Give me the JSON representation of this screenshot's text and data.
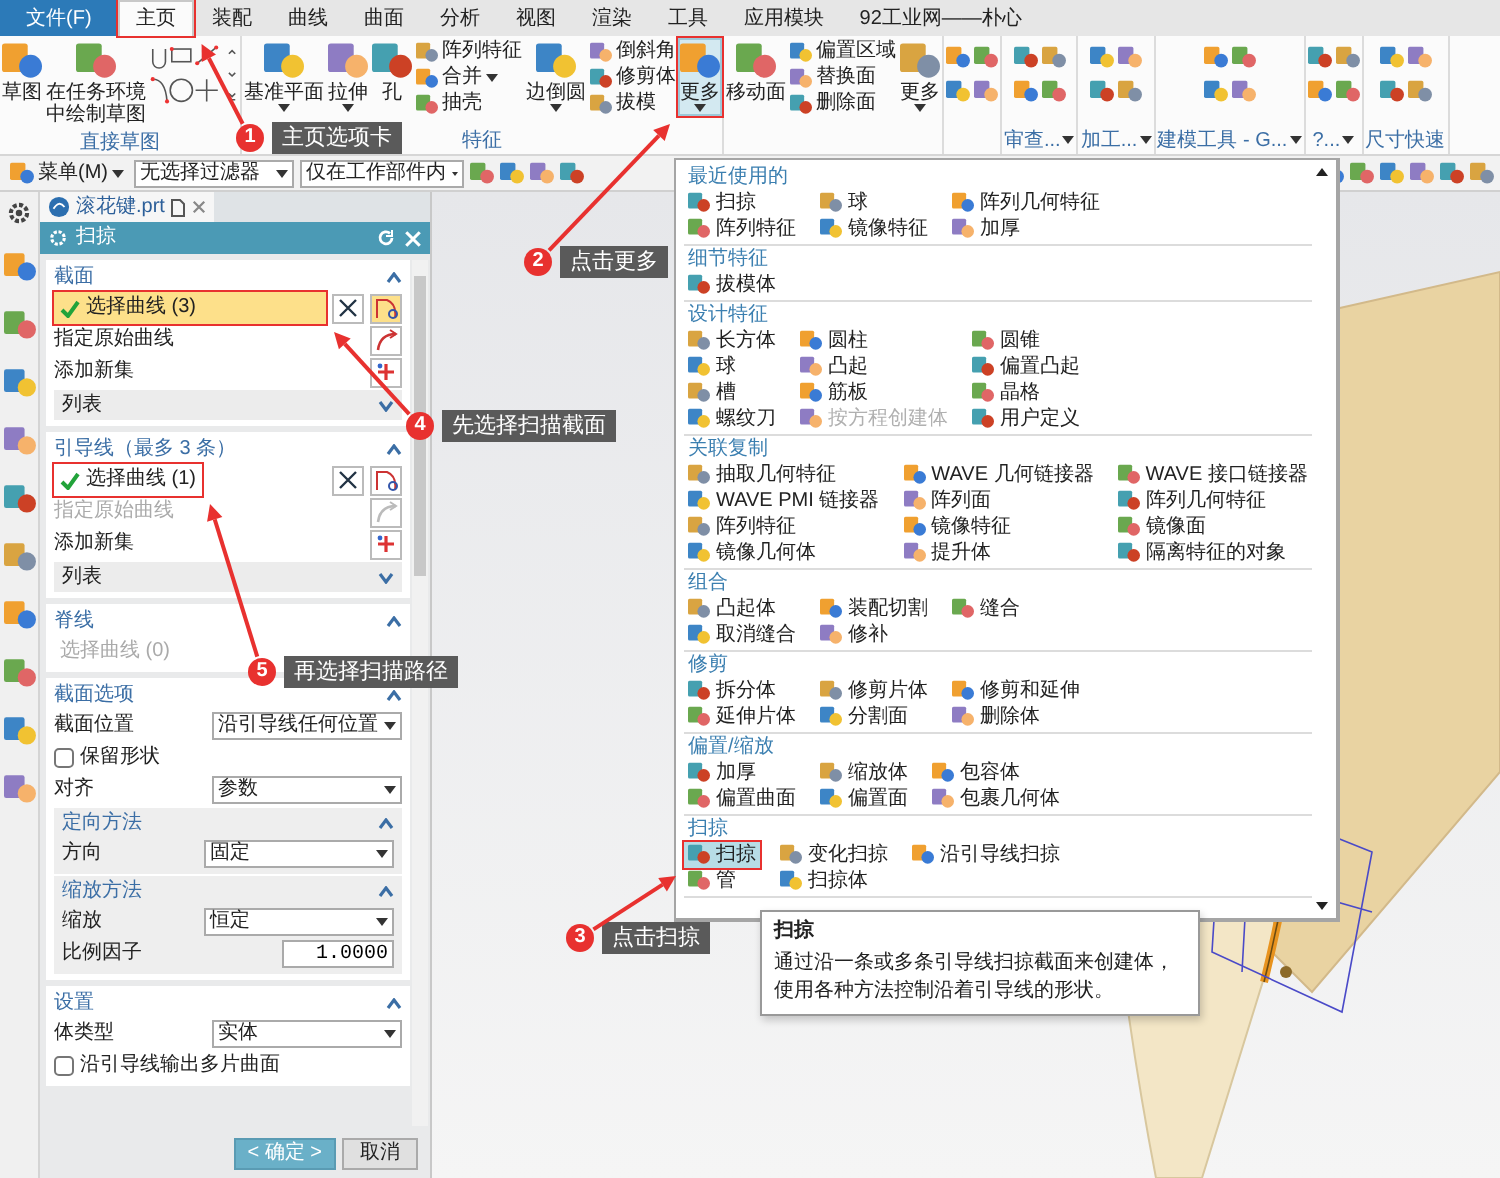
{
  "menu_bar": {
    "tabs": [
      {
        "label": "文件(F)",
        "kind": "file",
        "selected": false
      },
      {
        "label": "主页",
        "kind": "tab",
        "selected": true,
        "callout": {
          "number": "1",
          "text": "主页选项卡"
        }
      },
      {
        "label": "装配",
        "kind": "tab",
        "selected": false
      },
      {
        "label": "曲线",
        "kind": "tab",
        "selected": false
      },
      {
        "label": "曲面",
        "kind": "tab",
        "selected": false
      },
      {
        "label": "分析",
        "kind": "tab",
        "selected": false
      },
      {
        "label": "视图",
        "kind": "tab",
        "selected": false
      },
      {
        "label": "渲染",
        "kind": "tab",
        "selected": false
      },
      {
        "label": "工具",
        "kind": "tab",
        "selected": false
      },
      {
        "label": "应用模块",
        "kind": "tab",
        "selected": false
      },
      {
        "label": "92工业网——朴心",
        "kind": "tab",
        "selected": false
      }
    ]
  },
  "ribbon": {
    "groups": [
      {
        "label": "直接草图",
        "dropdown": false,
        "items": [
          {
            "kind": "large",
            "label": "草图",
            "dropdown": false,
            "pressed": false
          },
          {
            "kind": "large",
            "label": "在任务环境中绘制草图",
            "dropdown": false,
            "pressed": false
          },
          {
            "kind": "gallery"
          }
        ]
      },
      {
        "label": "特征",
        "dropdown": false,
        "items": [
          {
            "kind": "large",
            "label": "基准平面",
            "dropdown": true,
            "pressed": false
          },
          {
            "kind": "large",
            "label": "拉伸",
            "dropdown": true,
            "pressed": false
          },
          {
            "kind": "large",
            "label": "孔",
            "dropdown": false,
            "pressed": false
          },
          {
            "kind": "stack",
            "entries": [
              {
                "label": "阵列特征",
                "dropdown": false
              },
              {
                "label": "合并",
                "dropdown": true
              },
              {
                "label": "抽壳",
                "dropdown": false
              }
            ]
          },
          {
            "kind": "large",
            "label": "边倒圆",
            "dropdown": true,
            "pressed": false
          },
          {
            "kind": "stack",
            "entries": [
              {
                "label": "倒斜角",
                "dropdown": false
              },
              {
                "label": "修剪体",
                "dropdown": false
              },
              {
                "label": "拔模",
                "dropdown": false
              }
            ]
          },
          {
            "kind": "large",
            "label": "更多",
            "dropdown": true,
            "pressed": true,
            "callout": {
              "number": "2",
              "text": "点击更多"
            }
          }
        ]
      },
      {
        "items": [
          {
            "kind": "large",
            "label": "移动面",
            "dropdown": false,
            "pressed": false
          },
          {
            "kind": "stack",
            "entries": [
              {
                "label": "偏置区域",
                "dropdown": false
              },
              {
                "label": "替换面",
                "dropdown": false
              },
              {
                "label": "删除面",
                "dropdown": false
              }
            ]
          },
          {
            "kind": "large",
            "label": "更多",
            "dropdown": true,
            "pressed": false
          }
        ]
      },
      {
        "items": [
          {
            "kind": "icons"
          }
        ]
      },
      {
        "label": "审查...",
        "dropdown": true,
        "items": [
          {
            "kind": "icons"
          }
        ]
      },
      {
        "label": "加工...",
        "dropdown": true,
        "items": [
          {
            "kind": "icons"
          }
        ]
      },
      {
        "label": "建模工具 - G...",
        "dropdown": true,
        "items": [
          {
            "kind": "icons"
          }
        ]
      },
      {
        "label": "?...",
        "dropdown": true,
        "items": [
          {
            "kind": "icons"
          }
        ]
      },
      {
        "label": "尺寸快速",
        "dropdown": false,
        "items": [
          {
            "kind": "icons"
          }
        ]
      }
    ]
  },
  "toolbar": {
    "menu_button": "菜单(M)",
    "filters": [
      "无选择过滤器",
      "仅在工作部件内"
    ]
  },
  "file_tab": {
    "label": "滚花键.prt"
  },
  "dialog": {
    "title": "扫掠",
    "sections": [
      {
        "title": "截面",
        "expanded": true,
        "rows": [
          {
            "kind": "select",
            "label": "选择曲线 (3)",
            "done": true,
            "active": true,
            "disabled": false,
            "callout": {
              "number": "4",
              "text": "先选择扫描截面"
            }
          },
          {
            "kind": "specify",
            "label": "指定原始曲线",
            "disabled": false
          },
          {
            "kind": "add_set",
            "label": "添加新集"
          },
          {
            "kind": "list",
            "label": "列表",
            "expanded": false
          }
        ]
      },
      {
        "title": "引导线（最多 3 条）",
        "expanded": true,
        "rows": [
          {
            "kind": "select",
            "label": "选择曲线 (1)",
            "done": true,
            "active": false,
            "disabled": false,
            "callout": {
              "number": "5",
              "text": "再选择扫描路径"
            }
          },
          {
            "kind": "specify",
            "label": "指定原始曲线",
            "disabled": true
          },
          {
            "kind": "add_set",
            "label": "添加新集"
          },
          {
            "kind": "list",
            "label": "列表",
            "expanded": false
          }
        ]
      },
      {
        "title": "脊线",
        "expanded": true,
        "rows": [
          {
            "kind": "select",
            "label": "选择曲线 (0)",
            "done": false,
            "active": false,
            "disabled": true
          }
        ]
      },
      {
        "title": "截面选项",
        "expanded": true,
        "rows": [
          {
            "kind": "dropdown",
            "label": "截面位置",
            "value": "沿引导线任何位置"
          },
          {
            "kind": "checkbox",
            "label": "保留形状",
            "checked": false
          },
          {
            "kind": "dropdown",
            "label": "对齐",
            "value": "参数"
          },
          {
            "kind": "subsection",
            "title": "定向方法",
            "expanded": true,
            "rows": [
              {
                "kind": "dropdown",
                "label": "方向",
                "value": "固定"
              }
            ]
          },
          {
            "kind": "subsection",
            "title": "缩放方法",
            "expanded": true,
            "rows": [
              {
                "kind": "dropdown",
                "label": "缩放",
                "value": "恒定"
              },
              {
                "kind": "number",
                "label": "比例因子",
                "value": "1.0000"
              }
            ]
          }
        ]
      },
      {
        "title": "设置",
        "expanded": true,
        "rows": [
          {
            "kind": "dropdown",
            "label": "体类型",
            "value": "实体"
          },
          {
            "kind": "checkbox",
            "label": "沿引导线输出多片曲面",
            "checked": false
          }
        ]
      }
    ],
    "buttons": [
      {
        "label": "< 确定 >",
        "primary": true
      },
      {
        "label": "取消",
        "primary": false
      }
    ]
  },
  "menu": {
    "sections": [
      {
        "title": "最近使用的",
        "items": [
          {
            "label": "扫掠",
            "disabled": false,
            "highlighted": false
          },
          {
            "label": "球",
            "disabled": false,
            "highlighted": false
          },
          {
            "label": "阵列几何特征",
            "disabled": false,
            "highlighted": false
          },
          {
            "label": "阵列特征",
            "disabled": false,
            "highlighted": false
          },
          {
            "label": "镜像特征",
            "disabled": false,
            "highlighted": false
          },
          {
            "label": "加厚",
            "disabled": false,
            "highlighted": false
          }
        ]
      },
      {
        "title": "细节特征",
        "items": [
          {
            "label": "拔模体",
            "disabled": false,
            "highlighted": false
          }
        ]
      },
      {
        "title": "设计特征",
        "items": [
          {
            "label": "长方体",
            "disabled": false,
            "highlighted": false
          },
          {
            "label": "圆柱",
            "disabled": false,
            "highlighted": false
          },
          {
            "label": "圆锥",
            "disabled": false,
            "highlighted": false
          },
          {
            "label": "球",
            "disabled": false,
            "highlighted": false
          },
          {
            "label": "凸起",
            "disabled": false,
            "highlighted": false
          },
          {
            "label": "偏置凸起",
            "disabled": false,
            "highlighted": false
          },
          {
            "label": "槽",
            "disabled": false,
            "highlighted": false
          },
          {
            "label": "筋板",
            "disabled": false,
            "highlighted": false
          },
          {
            "label": "晶格",
            "disabled": false,
            "highlighted": false
          },
          {
            "label": "螺纹刀",
            "disabled": false,
            "highlighted": false
          },
          {
            "label": "按方程创建体",
            "disabled": true,
            "highlighted": false
          },
          {
            "label": "用户定义",
            "disabled": false,
            "highlighted": false
          }
        ]
      },
      {
        "title": "关联复制",
        "items": [
          {
            "label": "抽取几何特征",
            "disabled": false,
            "highlighted": false
          },
          {
            "label": "WAVE 几何链接器",
            "disabled": false,
            "highlighted": false
          },
          {
            "label": "WAVE 接口链接器",
            "disabled": false,
            "highlighted": false
          },
          {
            "label": "WAVE PMI 链接器",
            "disabled": false,
            "highlighted": false
          },
          {
            "label": "阵列面",
            "disabled": false,
            "highlighted": false
          },
          {
            "label": "阵列几何特征",
            "disabled": false,
            "highlighted": false
          },
          {
            "label": "阵列特征",
            "disabled": false,
            "highlighted": false
          },
          {
            "label": "镜像特征",
            "disabled": false,
            "highlighted": false
          },
          {
            "label": "镜像面",
            "disabled": false,
            "highlighted": false
          },
          {
            "label": "镜像几何体",
            "disabled": false,
            "highlighted": false
          },
          {
            "label": "提升体",
            "disabled": false,
            "highlighted": false
          },
          {
            "label": "隔离特征的对象",
            "disabled": false,
            "highlighted": false
          }
        ]
      },
      {
        "title": "组合",
        "items": [
          {
            "label": "凸起体",
            "disabled": false,
            "highlighted": false
          },
          {
            "label": "装配切割",
            "disabled": false,
            "highlighted": false
          },
          {
            "label": "缝合",
            "disabled": false,
            "highlighted": false
          },
          {
            "label": "取消缝合",
            "disabled": false,
            "highlighted": false
          },
          {
            "label": "修补",
            "disabled": false,
            "highlighted": false
          }
        ]
      },
      {
        "title": "修剪",
        "items": [
          {
            "label": "拆分体",
            "disabled": false,
            "highlighted": false
          },
          {
            "label": "修剪片体",
            "disabled": false,
            "highlighted": false
          },
          {
            "label": "修剪和延伸",
            "disabled": false,
            "highlighted": false
          },
          {
            "label": "延伸片体",
            "disabled": false,
            "highlighted": false
          },
          {
            "label": "分割面",
            "disabled": false,
            "highlighted": false
          },
          {
            "label": "删除体",
            "disabled": false,
            "highlighted": false
          }
        ]
      },
      {
        "title": "偏置/缩放",
        "items": [
          {
            "label": "加厚",
            "disabled": false,
            "highlighted": false
          },
          {
            "label": "缩放体",
            "disabled": false,
            "highlighted": false
          },
          {
            "label": "包容体",
            "disabled": false,
            "highlighted": false
          },
          {
            "label": "偏置曲面",
            "disabled": false,
            "highlighted": false
          },
          {
            "label": "偏置面",
            "disabled": false,
            "highlighted": false
          },
          {
            "label": "包裹几何体",
            "disabled": false,
            "highlighted": false
          }
        ]
      },
      {
        "title": "扫掠",
        "items": [
          {
            "label": "扫掠",
            "disabled": false,
            "highlighted": true,
            "callout": {
              "number": "3",
              "text": "点击扫掠"
            }
          },
          {
            "label": "变化扫掠",
            "disabled": false,
            "highlighted": false
          },
          {
            "label": "沿引导线扫掠",
            "disabled": false,
            "highlighted": false
          },
          {
            "label": "管",
            "disabled": false,
            "highlighted": false
          },
          {
            "label": "扫掠体",
            "disabled": false,
            "highlighted": false
          }
        ]
      }
    ]
  },
  "tooltip": {
    "title": "扫掠",
    "text": "通过沿一条或多条引导线扫掠截面来创建体，使用各种方法控制沿着引导线的形状。"
  }
}
